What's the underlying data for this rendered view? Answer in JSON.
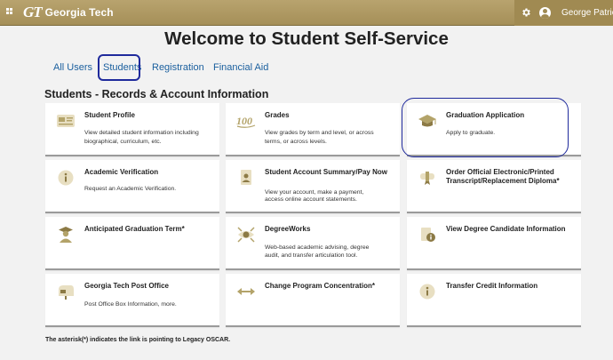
{
  "header": {
    "logo_mark": "GT",
    "logo_text": "Georgia Tech",
    "user_name": "George Patrick B",
    "icons": [
      "apps-grid-icon",
      "gear-icon",
      "user-avatar-icon"
    ]
  },
  "page_title": "Welcome to Student Self-Service",
  "tabs": [
    {
      "label": "All Users"
    },
    {
      "label": "Students",
      "selected": true
    },
    {
      "label": "Registration"
    },
    {
      "label": "Financial Aid"
    }
  ],
  "section_title": "Students - Records & Account Information",
  "cards": [
    {
      "title": "Student Profile",
      "desc1": "View detailed student information including",
      "desc2": "biographical, curriculum, etc.",
      "icon": "id-card-icon"
    },
    {
      "title": "Grades",
      "desc1": "View grades by term and level, or across",
      "desc2": "terms, or across levels.",
      "icon": "grade-100-icon"
    },
    {
      "title": "Graduation Application",
      "desc1": "Apply to graduate.",
      "desc2": "",
      "icon": "graduation-cap-icon"
    },
    {
      "title": "Academic Verification",
      "desc1": "Request an Academic Verification.",
      "desc2": "",
      "icon": "info-icon"
    },
    {
      "title": "Student Account Summary/Pay Now",
      "desc1": "View your account, make a payment,",
      "desc2": "access online account statements.",
      "icon": "document-user-icon"
    },
    {
      "title": "Order Official Electronic/Printed Transcript/Replacement Diploma*",
      "desc1": "",
      "desc2": "",
      "icon": "diploma-icon"
    },
    {
      "title": "Anticipated Graduation Term*",
      "desc1": "",
      "desc2": "",
      "icon": "graduate-person-icon"
    },
    {
      "title": "DegreeWorks",
      "desc1": "Web-based academic advising, degree",
      "desc2": "audit, and transfer articulation tool.",
      "icon": "degreeworks-icon"
    },
    {
      "title": "View Degree Candidate Information",
      "desc1": "",
      "desc2": "",
      "icon": "info-document-icon"
    },
    {
      "title": "Georgia Tech Post Office",
      "desc1": "Post Office Box Information, more.",
      "desc2": "",
      "icon": "mailbox-icon"
    },
    {
      "title": "Change Program Concentration*",
      "desc1": "",
      "desc2": "",
      "icon": "swap-arrows-icon"
    },
    {
      "title": "Transfer Credit Information",
      "desc1": "",
      "desc2": "",
      "icon": "info-icon"
    }
  ],
  "footnote": "The asterisk(*) indicates the link is pointing to Legacy OSCAR.",
  "colors": {
    "gold": "#b3a369",
    "link_blue": "#1a5f9e",
    "annotation_blue": "#1f2a9c"
  }
}
